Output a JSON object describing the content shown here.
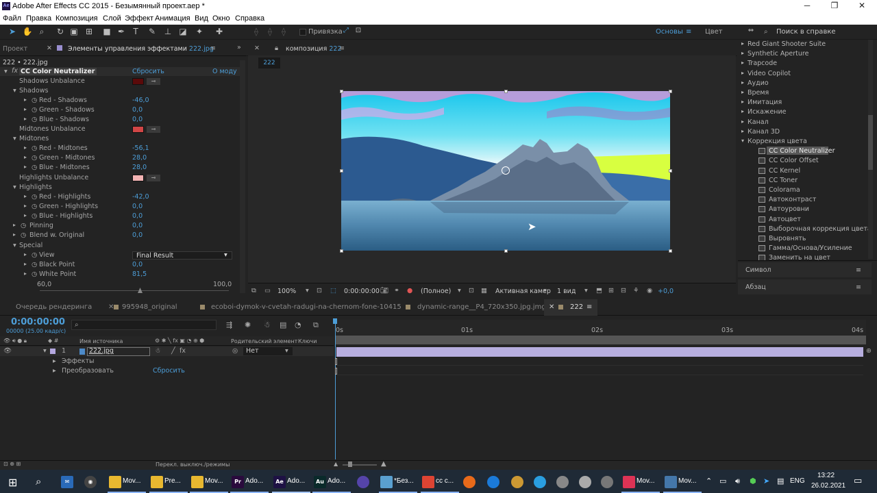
{
  "window": {
    "title": "Adobe After Effects CC 2015 - Безымянный проект.aep *",
    "icon": "Ae"
  },
  "menu": [
    "Файл",
    "Правка",
    "Композиция",
    "Слой",
    "Эффект",
    "Анимация",
    "Вид",
    "Окно",
    "Справка"
  ],
  "toolbar": {
    "snap_label": "Привязка",
    "workspace": "Основы",
    "workspace2": "Цвет",
    "search_placeholder": "Поиск в справке"
  },
  "left_panel": {
    "tab_project": "Проект",
    "tab_effects_prefix": "Элементы управления эффектами",
    "tab_effects_file": "222.jpg",
    "breadcrumb": "222 • 222.jpg",
    "effect": {
      "name": "CC Color Neutralizer",
      "reset": "Сбросить",
      "about": "О моду",
      "rows": [
        {
          "label": "Shadows Unbalance",
          "kind": "color",
          "color": "#5a0a0a"
        },
        {
          "label": "Shadows",
          "kind": "group"
        },
        {
          "label": "Red - Shadows",
          "value": "-46,0"
        },
        {
          "label": "Green - Shadows",
          "value": "0,0"
        },
        {
          "label": "Blue - Shadows",
          "value": "0,0"
        },
        {
          "label": "Midtones Unbalance",
          "kind": "color",
          "color": "#d14646"
        },
        {
          "label": "Midtones",
          "kind": "group"
        },
        {
          "label": "Red - Midtones",
          "value": "-56,1"
        },
        {
          "label": "Green - Midtones",
          "value": "28,0"
        },
        {
          "label": "Blue - Midtones",
          "value": "28,0"
        },
        {
          "label": "Highlights Unbalance",
          "kind": "color",
          "color": "#f2b3b3"
        },
        {
          "label": "Highlights",
          "kind": "group"
        },
        {
          "label": "Red - Highlights",
          "value": "-42,0"
        },
        {
          "label": "Green - Highlights",
          "value": "0,0"
        },
        {
          "label": "Blue - Highlights",
          "value": "0,0"
        },
        {
          "label": "Pinning",
          "value": "0,0"
        },
        {
          "label": "Blend w. Original",
          "value": "0,0"
        },
        {
          "label": "Special",
          "kind": "group"
        },
        {
          "label": "View",
          "kind": "select",
          "value": "Final Result"
        },
        {
          "label": "Black Point",
          "value": "0,0"
        },
        {
          "label": "White Point",
          "value": "81,5"
        }
      ],
      "slider_min": "60,0",
      "slider_max": "100,0"
    }
  },
  "comp_panel": {
    "tab_prefix": "композиция",
    "tab_name": "222",
    "chip": "222",
    "zoom": "100%",
    "timecode": "0:00:00:00",
    "resolution": "(Полное)",
    "camera": "Активная камер",
    "views": "1 вид",
    "exposure": "+0,0"
  },
  "right_panel": {
    "items": [
      "Red Giant Shooter Suite",
      "Synthetic Aperture",
      "Trapcode",
      "Video Copilot",
      "Аудио",
      "Время",
      "Имитация",
      "Искажение",
      "Канал",
      "Канал 3D"
    ],
    "open_category": "Коррекция цвета",
    "effects": [
      "CC Color Neutralizer",
      "CC Color Offset",
      "CC Kernel",
      "CC Toner",
      "Colorama",
      "Автоконтраст",
      "Автоуровни",
      "Автоцвет",
      "Выборочная коррекция цвета",
      "Выровнять",
      "Гамма/Основа/Усиление",
      "Заменить на цвет"
    ],
    "selected_effect": "CC Color Neutralizer",
    "symbol_panel": "Символ",
    "paragraph_panel": "Абзац"
  },
  "timeline": {
    "tabs": [
      "Очередь рендеринга",
      "995948_original",
      "ecoboi-dymok-v-cvetah-radugi-na-chernom-fone-10415",
      "dynamic-range__P4_720x350.jpg.jmg",
      "222"
    ],
    "active_tab": "222",
    "timecode": "0:00:00:00",
    "fps": "00000 (25.00 кадр/с)",
    "search_placeholder": "",
    "col_source": "Имя источника",
    "col_parent": "Родительский элемент",
    "col_keys": "Ключи",
    "layer_num": "1",
    "layer_name": "222.jpg",
    "parent_value": "Нет",
    "sub_effects": "Эффекты",
    "sub_transform": "Преобразовать",
    "reset": "Сбросить",
    "ruler": [
      "0s",
      "01s",
      "02s",
      "03s",
      "04s"
    ],
    "footer": "Перекл. выключ./режимы"
  },
  "taskbar": {
    "items": [
      {
        "label": "Mov...",
        "color": "#e8b830",
        "icon": "folder-icon"
      },
      {
        "label": "Pre...",
        "color": "#e8b830",
        "icon": "folder-icon"
      },
      {
        "label": "Mov...",
        "color": "#e8b830",
        "icon": "folder-icon"
      },
      {
        "label": "Ado...",
        "color": "#2a0a3d",
        "icon": "premiere-icon",
        "glyph": "Pr"
      },
      {
        "label": "Ado...",
        "color": "#1e1144",
        "icon": "aftereffects-icon",
        "glyph": "Ae"
      },
      {
        "label": "Ado...",
        "color": "#0a2a2a",
        "icon": "audition-icon",
        "glyph": "Au"
      },
      {
        "label": "*Без...",
        "color": "#5aa0d0",
        "icon": "notepad-icon"
      },
      {
        "label": "cc c...",
        "color": "#dd4433",
        "icon": "chrome-icon"
      },
      {
        "label": "Mov...",
        "color": "#dd3355",
        "icon": "movavi-icon"
      },
      {
        "label": "Mov...",
        "color": "#4477aa",
        "icon": "movavi-editor-icon"
      }
    ],
    "lang": "ENG",
    "time": "13:22",
    "date": "26.02.2021"
  }
}
